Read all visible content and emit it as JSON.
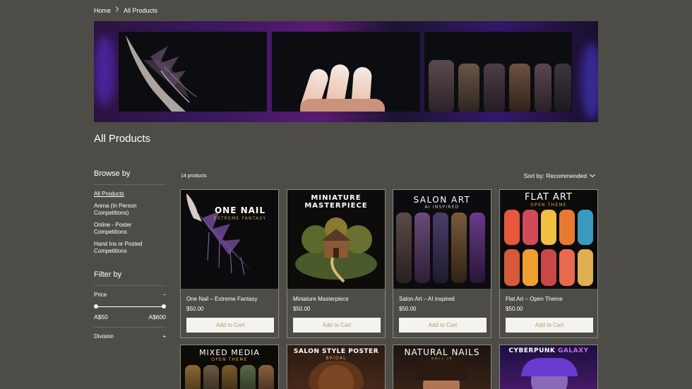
{
  "breadcrumb": {
    "home": "Home",
    "separator": "chevron-right-icon",
    "current": "All Products"
  },
  "page_title": "All Products",
  "sidebar": {
    "browse_heading": "Browse by",
    "categories": [
      {
        "label": "All Products",
        "active": true
      },
      {
        "label": "Arena (In Person Competitions)",
        "active": false
      },
      {
        "label": "Online - Poster Competitions",
        "active": false
      },
      {
        "label": "Hand Ins or Posted Competitions",
        "active": false
      }
    ],
    "filter_heading": "Filter by",
    "price": {
      "label": "Price",
      "toggle": "−",
      "min": "A$50",
      "max": "A$600",
      "range_fraction": [
        0,
        1
      ]
    },
    "division": {
      "label": "Division",
      "toggle": "+"
    }
  },
  "products_count": "14 products",
  "sort": {
    "label": "Sort by: Recommended",
    "icon": "chevron-down-icon"
  },
  "products": [
    {
      "name": "One Nail – Extreme Fantasy",
      "price": "$50.00",
      "button": "Add to Cart",
      "image_title": "ONE NAIL",
      "image_subtitle": "EXTREME FANTASY"
    },
    {
      "name": "Miniature Masterpiece",
      "price": "$50.00",
      "button": "Add to Cart",
      "image_title": "MINIATURE MASTERPIECE",
      "image_subtitle": ""
    },
    {
      "name": "Salon Art – AI inspired",
      "price": "$50.00",
      "button": "Add to Cart",
      "image_title": "SALON ART",
      "image_subtitle": "AI INSPIRED"
    },
    {
      "name": "Flat Art – Open Theme",
      "price": "$50.00",
      "button": "Add to Cart",
      "image_title": "FLAT ART",
      "image_subtitle": "OPEN THEME"
    },
    {
      "image_title": "MIXED MEDIA",
      "image_subtitle": "OPEN THEME"
    },
    {
      "image_title": "SALON STYLE POSTER",
      "image_subtitle": "BRIDAL"
    },
    {
      "image_title": "NATURAL NAILS",
      "image_subtitle": "SELL IT"
    },
    {
      "image_title": "CYBERPUNK",
      "image_title_accent": "GALAXY",
      "image_subtitle": ""
    }
  ],
  "colors": {
    "page_bg": "#4e4c47",
    "button_bg": "#f4f3ef",
    "button_text": "#b9a060",
    "accent_purple": "#7b3fd0"
  }
}
